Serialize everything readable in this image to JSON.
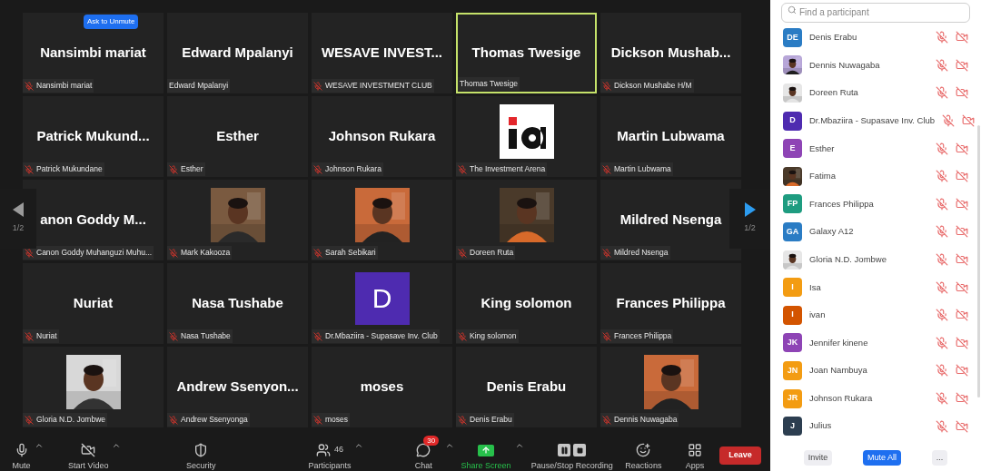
{
  "gallery": {
    "page_left": "1/2",
    "page_right": "1/2",
    "tiles": [
      {
        "kind": "name",
        "big_name": "Nansimbi mariat",
        "label": "Nansimbi mariat",
        "muted": true,
        "active": false,
        "badge": "Ask to Unmute"
      },
      {
        "kind": "name",
        "big_name": "Edward Mpalanyi",
        "label": "Edward Mpalanyi",
        "muted": false,
        "active": false
      },
      {
        "kind": "name",
        "big_name": "WESAVE  INVEST...",
        "label": "WESAVE INVESTMENT CLUB",
        "muted": true,
        "active": false
      },
      {
        "kind": "name",
        "big_name": "Thomas Twesige",
        "label": "Thomas Twesige",
        "muted": false,
        "active": true
      },
      {
        "kind": "name",
        "big_name": "Dickson  Mushab...",
        "label": "Dickson Mushabe H/M",
        "muted": true,
        "active": false
      },
      {
        "kind": "name",
        "big_name": "Patrick  Mukund...",
        "label": "Patrick Mukundane",
        "muted": true,
        "active": false
      },
      {
        "kind": "name",
        "big_name": "Esther",
        "label": "Esther",
        "muted": true,
        "active": false
      },
      {
        "kind": "name",
        "big_name": "Johnson Rukara",
        "label": "Johnson Rukara",
        "muted": true,
        "active": false
      },
      {
        "kind": "logo",
        "label": "The Investment Arena",
        "muted": true,
        "active": false
      },
      {
        "kind": "name",
        "big_name": "Martin Lubwama",
        "label": "Martin Lubwama",
        "muted": true,
        "active": false
      },
      {
        "kind": "name",
        "big_name": "anon  Goddy  M...",
        "label": "Canon Goddy Muhanguzi Muhu...",
        "muted": true,
        "active": false
      },
      {
        "kind": "picture",
        "label": "Mark Kakooza",
        "muted": true,
        "active": false
      },
      {
        "kind": "picture",
        "label": "Sarah Sebikari",
        "muted": true,
        "active": false
      },
      {
        "kind": "picture",
        "label": "Doreen Ruta",
        "muted": true,
        "active": false
      },
      {
        "kind": "name",
        "big_name": "Mildred Nsenga",
        "label": "Mildred Nsenga",
        "muted": true,
        "active": false
      },
      {
        "kind": "name",
        "big_name": "Nuriat",
        "label": "Nuriat",
        "muted": true,
        "active": false
      },
      {
        "kind": "name",
        "big_name": "Nasa Tushabe",
        "label": "Nasa Tushabe",
        "muted": true,
        "active": false
      },
      {
        "kind": "letter",
        "letter": "D",
        "color": "#4e2bb0",
        "label": "Dr.Mbaziira - Supasave Inv. Club",
        "muted": true,
        "active": false
      },
      {
        "kind": "name",
        "big_name": "King solomon",
        "label": "King solomon",
        "muted": true,
        "active": false
      },
      {
        "kind": "name",
        "big_name": "Frances Philippa",
        "label": "Frances Philippa",
        "muted": true,
        "active": false
      },
      {
        "kind": "picture",
        "label": "Gloria N.D. Jombwe",
        "muted": true,
        "active": false
      },
      {
        "kind": "name",
        "big_name": "Andrew  Ssenyon...",
        "label": "Andrew Ssenyonga",
        "muted": true,
        "active": false
      },
      {
        "kind": "name",
        "big_name": "moses",
        "label": "moses",
        "muted": true,
        "active": false
      },
      {
        "kind": "name",
        "big_name": "Denis Erabu",
        "label": "Denis Erabu",
        "muted": true,
        "active": false
      },
      {
        "kind": "picture",
        "label": "Dennis Nuwagaba",
        "muted": true,
        "active": false
      }
    ]
  },
  "toolbar": {
    "items": [
      {
        "kind": "mic",
        "label": "Mute",
        "menu": true
      },
      {
        "kind": "video",
        "label": "Start Video",
        "menu": true
      },
      {
        "kind": "security",
        "label": "Security",
        "menu": false
      },
      {
        "kind": "participants",
        "label": "Participants",
        "count": "46",
        "menu": true
      },
      {
        "kind": "chat",
        "label": "Chat",
        "badge": "30",
        "menu": true
      },
      {
        "kind": "share",
        "label": "Share Screen",
        "menu": true
      },
      {
        "kind": "record",
        "label": "Pause/Stop Recording",
        "menu": false
      },
      {
        "kind": "reactions",
        "label": "Reactions",
        "menu": false
      },
      {
        "kind": "apps",
        "label": "Apps",
        "menu": false
      }
    ],
    "leave": "Leave"
  },
  "participants_panel": {
    "search": {
      "placeholder": "Find a participant"
    },
    "participants": [
      {
        "name": "Denis Erabu",
        "avatar": {
          "kind": "initials",
          "text": "DE",
          "color": "#2a7cc4"
        },
        "mic_muted": true,
        "video_off": true
      },
      {
        "name": "Dennis Nuwagaba",
        "mic_muted": true,
        "video_off": true
      },
      {
        "name": "Doreen Ruta",
        "mic_muted": true,
        "video_off": true
      },
      {
        "name": "Dr.Mbaziira - Supasave Inv. Club",
        "avatar": {
          "kind": "initials",
          "text": "D",
          "color": "#4e2bb0"
        },
        "mic_muted": true,
        "video_off": true
      },
      {
        "name": "Esther",
        "avatar": {
          "kind": "initials",
          "text": "E",
          "color": "#8e44b5"
        },
        "mic_muted": true,
        "video_off": true
      },
      {
        "name": "Fatima",
        "mic_muted": true,
        "video_off": true
      },
      {
        "name": "Frances Philippa",
        "avatar": {
          "kind": "initials",
          "text": "FP",
          "color": "#1e9c80"
        },
        "mic_muted": true,
        "video_off": true
      },
      {
        "name": "Galaxy A12",
        "avatar": {
          "kind": "initials",
          "text": "GA",
          "color": "#2a7cc4"
        },
        "mic_muted": true,
        "video_off": true
      },
      {
        "name": "Gloria N.D. Jombwe",
        "mic_muted": true,
        "video_off": true
      },
      {
        "name": "Isa",
        "avatar": {
          "kind": "initials",
          "text": "I",
          "color": "#f39c12"
        },
        "mic_muted": true,
        "video_off": true
      },
      {
        "name": "ivan",
        "avatar": {
          "kind": "initials",
          "text": "I",
          "color": "#d35400"
        },
        "mic_muted": true,
        "video_off": true
      },
      {
        "name": "Jennifer kinene",
        "avatar": {
          "kind": "initials",
          "text": "JK",
          "color": "#8e44b5"
        },
        "mic_muted": true,
        "video_off": true
      },
      {
        "name": "Joan Nambuya",
        "avatar": {
          "kind": "initials",
          "text": "JN",
          "color": "#f39c12"
        },
        "mic_muted": true,
        "video_off": true
      },
      {
        "name": "Johnson Rukara",
        "avatar": {
          "kind": "initials",
          "text": "JR",
          "color": "#f39c12"
        },
        "mic_muted": true,
        "video_off": true
      },
      {
        "name": "Julius",
        "avatar": {
          "kind": "initials",
          "text": "J",
          "color": "#2c3e50"
        },
        "mic_muted": true,
        "video_off": true
      }
    ],
    "buttons": [
      {
        "kind": "plain",
        "label": "Invite"
      },
      {
        "kind": "primary",
        "label": "Mute All"
      },
      {
        "kind": "plain",
        "label": "..."
      }
    ]
  }
}
